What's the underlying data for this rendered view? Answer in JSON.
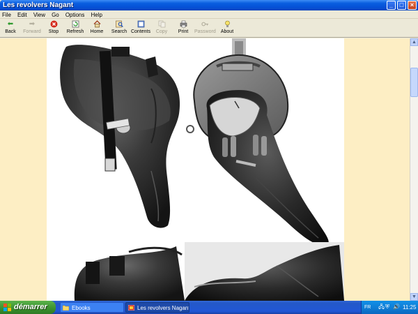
{
  "window": {
    "title": "Les revolvers Nagant"
  },
  "menu": [
    "File",
    "Edit",
    "View",
    "Go",
    "Options",
    "Help"
  ],
  "toolbar": {
    "back": "Back",
    "forward": "Forward",
    "stop": "Stop",
    "refresh": "Refresh",
    "home": "Home",
    "search": "Search",
    "contents": "Contents",
    "copy": "Copy",
    "print": "Print",
    "password": "Password",
    "about": "About"
  },
  "taskbar": {
    "start_label": "démarrer",
    "tasks": [
      "Ebooks",
      "Les revolvers Nagant"
    ],
    "language": "FR",
    "clock": "11:25"
  },
  "colors": {
    "page_margin": "#fdeec4",
    "titlebar": "#0a5fe0",
    "start_button": "#3a8f2e"
  }
}
